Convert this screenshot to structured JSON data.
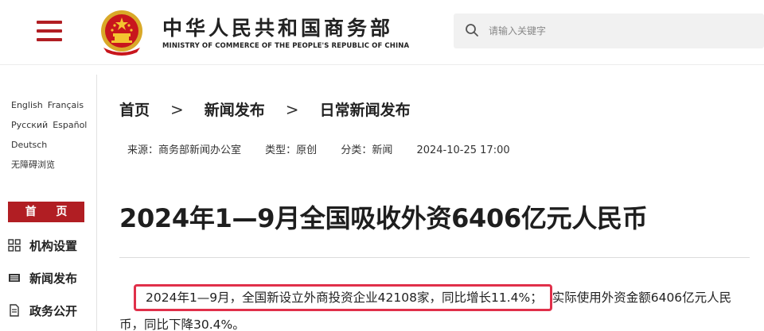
{
  "header": {
    "title": "中华人民共和国商务部",
    "subtitle": "MINISTRY OF COMMERCE OF THE PEOPLE'S REPUBLIC OF CHINA",
    "search_placeholder": "请输入关键字"
  },
  "sidebar": {
    "languages": {
      "english": "English",
      "french": "Français",
      "russian": "Русский",
      "spanish": "Español",
      "german": "Deutsch",
      "accessible": "无障碍浏览"
    },
    "home_label": "首 页",
    "nav": [
      {
        "label": "机构设置",
        "icon": "grid-icon"
      },
      {
        "label": "新闻发布",
        "icon": "newspaper-icon"
      },
      {
        "label": "政务公开",
        "icon": "document-icon"
      }
    ]
  },
  "breadcrumb": {
    "items": [
      "首页",
      "新闻发布",
      "日常新闻发布"
    ],
    "separator": ">"
  },
  "meta": {
    "source": "来源：商务部新闻办公室",
    "type": "类型：原创",
    "category": "分类：新闻",
    "datetime": "2024-10-25 17:00"
  },
  "article": {
    "title": "2024年1—9月全国吸收外资6406亿元人民币",
    "highlighted": "2024年1—9月，全国新设立外商投资企业42108家，同比增长11.4%；",
    "rest": "实际使用外资金额6406亿元人民币，同比下降30.4%。"
  },
  "colors": {
    "brand_red": "#b11e23",
    "highlight_border": "#e0304a"
  }
}
